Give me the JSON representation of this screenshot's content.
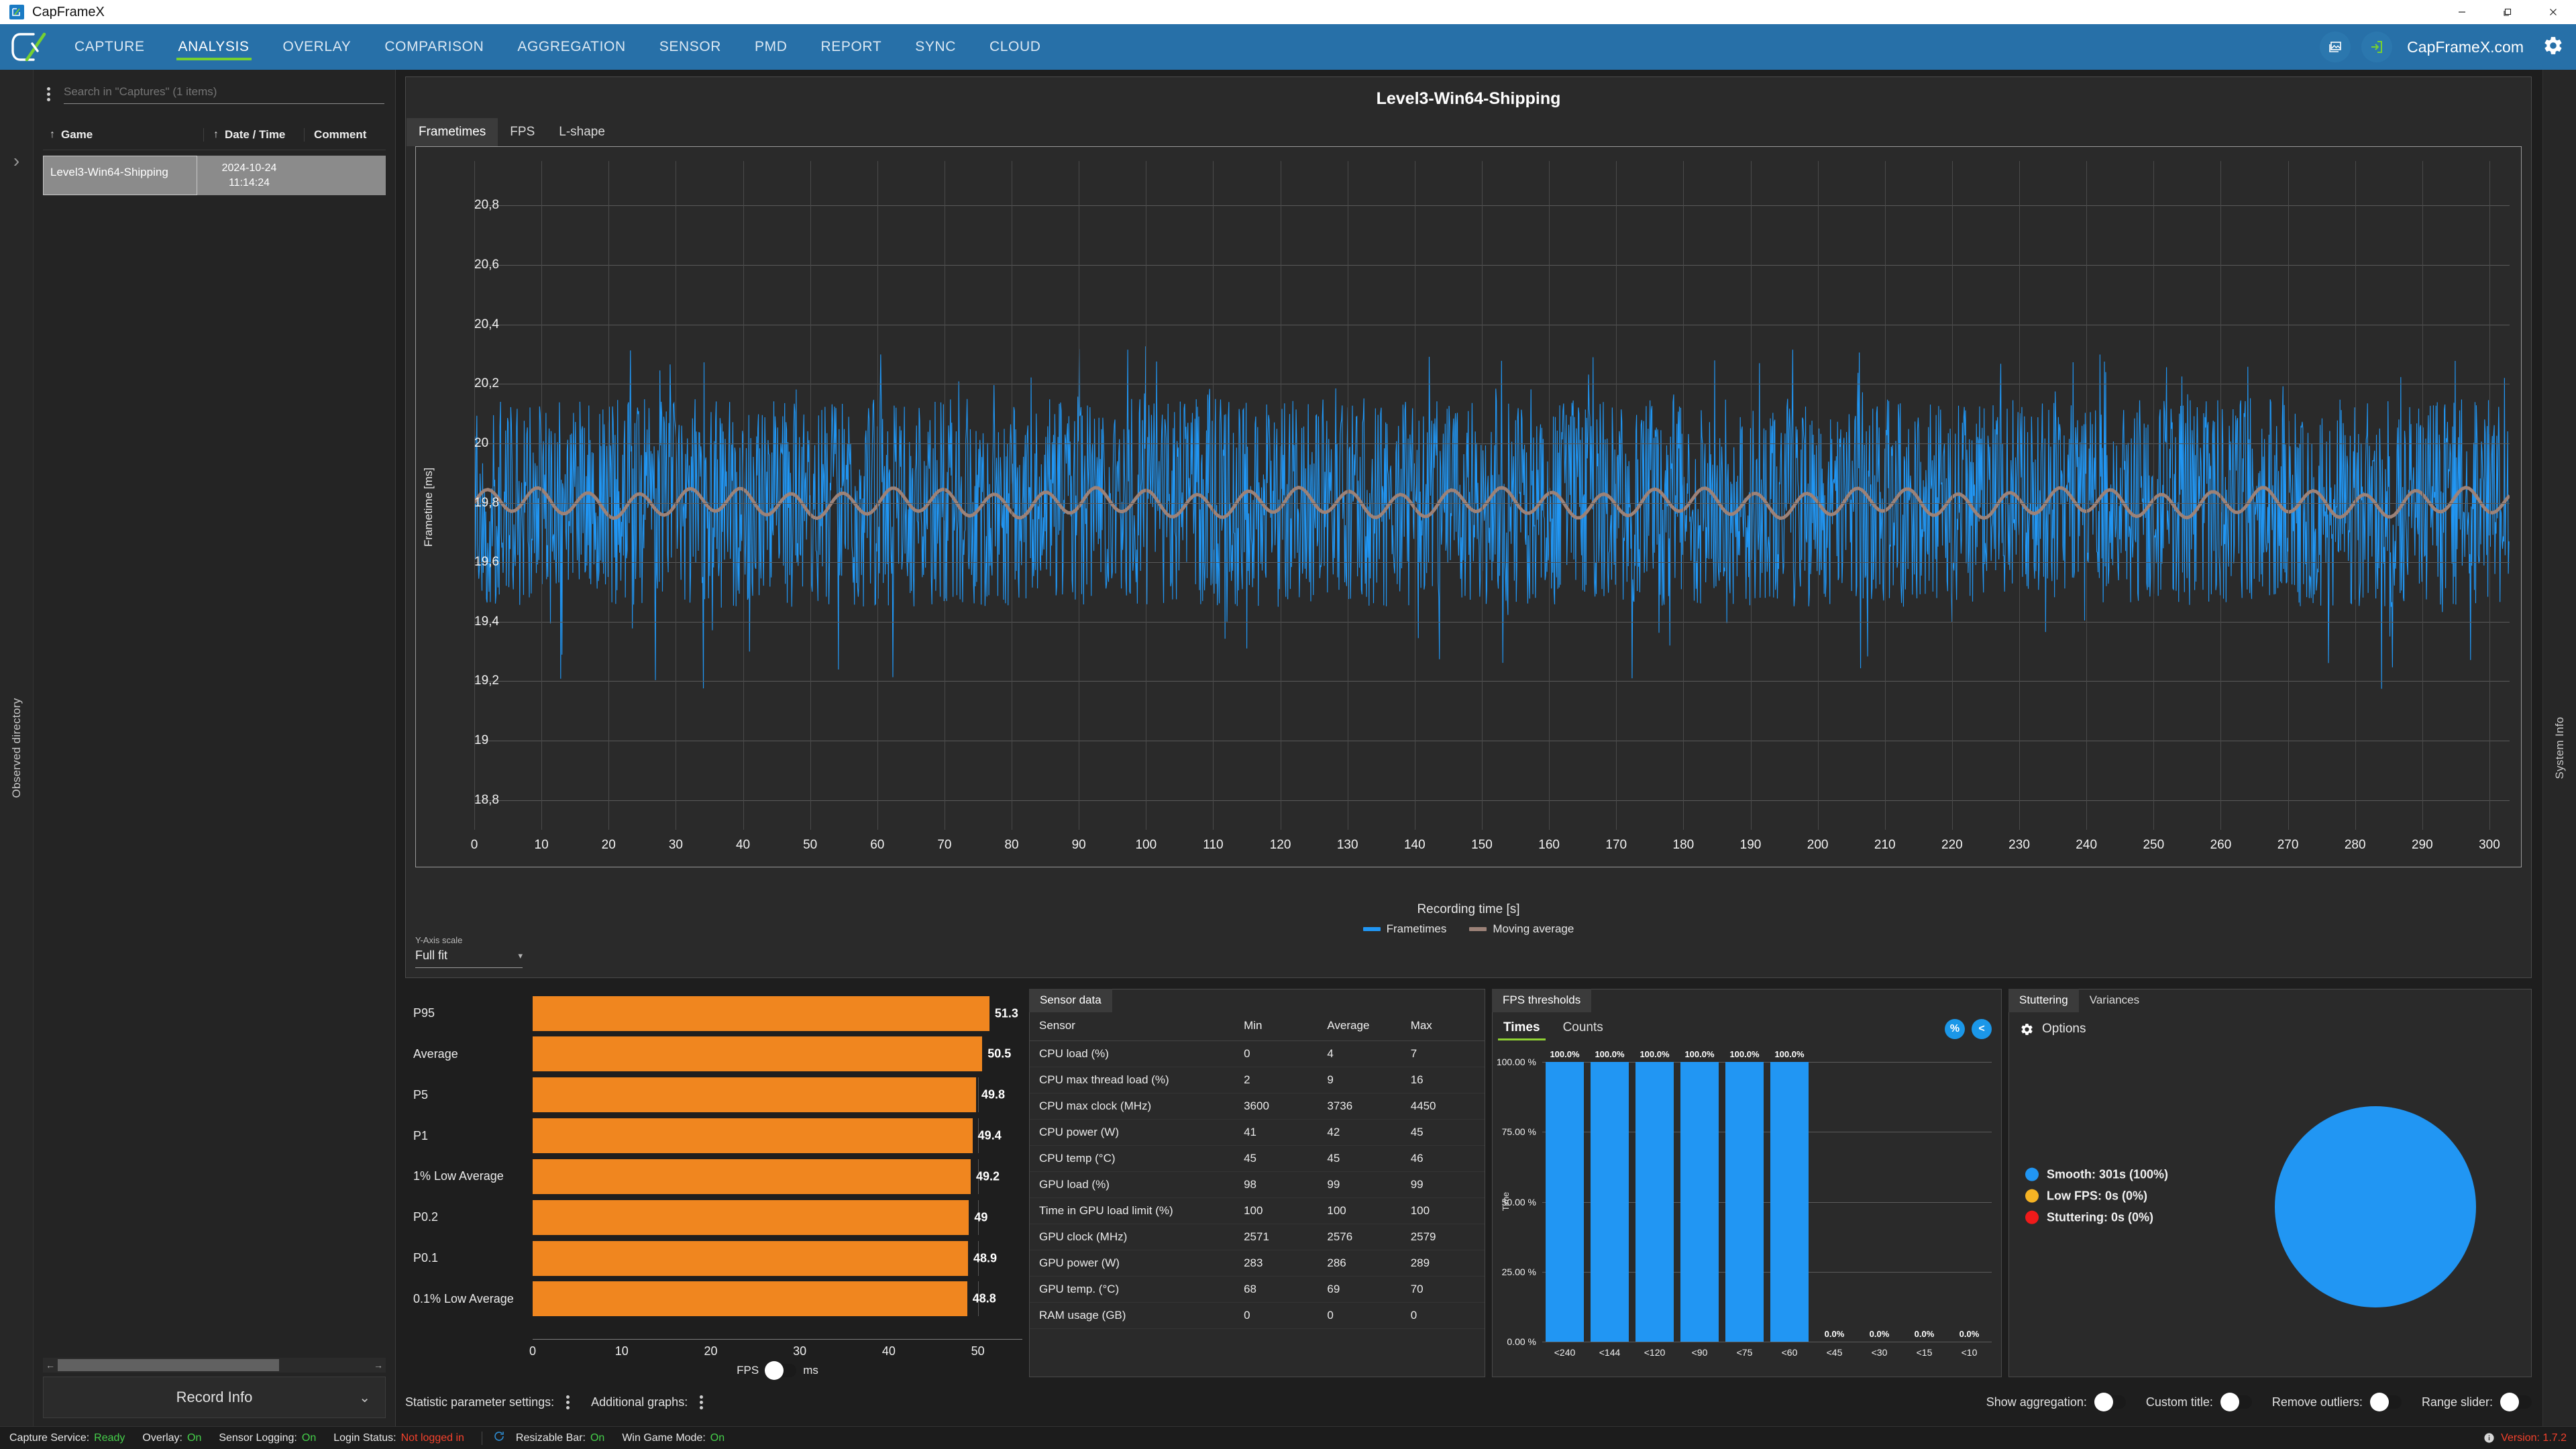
{
  "window": {
    "app_title": "CapFrameX",
    "logo_text": "CX",
    "minimize": "—",
    "maximize": "❐",
    "close": "✕"
  },
  "nav": {
    "items": [
      {
        "label": "CAPTURE",
        "active": false
      },
      {
        "label": "ANALYSIS",
        "active": true
      },
      {
        "label": "OVERLAY",
        "active": false
      },
      {
        "label": "COMPARISON",
        "active": false
      },
      {
        "label": "AGGREGATION",
        "active": false
      },
      {
        "label": "SENSOR",
        "active": false
      },
      {
        "label": "PMD",
        "active": false
      },
      {
        "label": "REPORT",
        "active": false
      },
      {
        "label": "SYNC",
        "active": false
      },
      {
        "label": "CLOUD",
        "active": false
      }
    ],
    "screenshot_icon": "image-icon",
    "login_icon": "login-icon",
    "site_link": "CapFrameX.com",
    "settings_icon": "gear-icon"
  },
  "left_rail": {
    "expand_icon": "chevron-right-icon",
    "label": "Observed directory"
  },
  "right_rail": {
    "label": "System Info"
  },
  "captures": {
    "kebab_icon": "kebab-menu-icon",
    "search_placeholder": "Search in \"Captures\" (1 items)",
    "search_value": "",
    "columns": [
      "Game",
      "Date / Time",
      "Comment"
    ],
    "rows": [
      {
        "game": "Level3-Win64-Shipping",
        "date": "2024-10-24",
        "time": "11:14:24",
        "comment": ""
      }
    ],
    "record_info": "Record Info",
    "record_info_chevron": "chevron-down-icon"
  },
  "chart_card": {
    "title": "Level3-Win64-Shipping",
    "tabs": [
      {
        "label": "Frametimes",
        "active": true
      },
      {
        "label": "FPS",
        "active": false
      },
      {
        "label": "L-shape",
        "active": false
      }
    ],
    "yaxis_scale_label": "Y-Axis scale",
    "yaxis_scale_value": "Full fit",
    "caret": "▾"
  },
  "chart_data": {
    "type": "line",
    "title": "Level3-Win64-Shipping",
    "xlabel": "Recording time [s]",
    "ylabel": "Frametime [ms]",
    "xlim": [
      0,
      303
    ],
    "ylim": [
      18.7,
      20.95
    ],
    "xticks": [
      0,
      10,
      20,
      30,
      40,
      50,
      60,
      70,
      80,
      90,
      100,
      110,
      120,
      130,
      140,
      150,
      160,
      170,
      180,
      190,
      200,
      210,
      220,
      230,
      240,
      250,
      260,
      270,
      280,
      290,
      300
    ],
    "ytick_labels": [
      "18,8",
      "19",
      "19,2",
      "19,4",
      "19,6",
      "19,8",
      "20",
      "20,2",
      "20,4",
      "20,6",
      "20,8"
    ],
    "yticks": [
      18.8,
      19.0,
      19.2,
      19.4,
      19.6,
      19.8,
      20.0,
      20.2,
      20.4,
      20.6,
      20.8
    ],
    "grid": true,
    "legend_position": "bottom",
    "series": [
      {
        "name": "Frametimes",
        "color": "#2196f3",
        "band_low": 19.45,
        "band_high": 20.15,
        "mean": 19.8
      },
      {
        "name": "Moving average",
        "color": "#9c8278",
        "mean": 19.8,
        "amplitude": 0.04
      }
    ]
  },
  "stats_chart": {
    "chart_data": {
      "type": "bar",
      "orientation": "horizontal",
      "categories": [
        "P95",
        "Average",
        "P5",
        "P1",
        "1% Low Average",
        "P0.2",
        "P0.1",
        "0.1% Low Average"
      ],
      "values": [
        51.3,
        50.5,
        49.8,
        49.4,
        49.2,
        49,
        48.9,
        48.8
      ],
      "value_labels": [
        "51.3",
        "50.5",
        "49.8",
        "49.4",
        "49.2",
        "49",
        "48.9",
        "48.8"
      ],
      "xticks": [
        0,
        10,
        20,
        30,
        40,
        50
      ],
      "xlim": [
        0,
        55
      ],
      "bar_color": "#f0861f",
      "xlabel": ""
    },
    "unit_left": "FPS",
    "unit_right": "ms"
  },
  "sensor_panel": {
    "tab": "Sensor data",
    "columns": [
      "Sensor",
      "Min",
      "Average",
      "Max"
    ],
    "rows": [
      {
        "sensor": "CPU load (%)",
        "min": "0",
        "avg": "4",
        "max": "7"
      },
      {
        "sensor": "CPU max thread load (%)",
        "min": "2",
        "avg": "9",
        "max": "16"
      },
      {
        "sensor": "CPU max clock (MHz)",
        "min": "3600",
        "avg": "3736",
        "max": "4450"
      },
      {
        "sensor": "CPU power (W)",
        "min": "41",
        "avg": "42",
        "max": "45"
      },
      {
        "sensor": "CPU temp (°C)",
        "min": "45",
        "avg": "45",
        "max": "46"
      },
      {
        "sensor": "GPU load (%)",
        "min": "98",
        "avg": "99",
        "max": "99"
      },
      {
        "sensor": "Time in GPU load limit (%)",
        "min": "100",
        "avg": "100",
        "max": "100"
      },
      {
        "sensor": "GPU clock (MHz)",
        "min": "2571",
        "avg": "2576",
        "max": "2579"
      },
      {
        "sensor": "GPU power (W)",
        "min": "283",
        "avg": "286",
        "max": "289"
      },
      {
        "sensor": "GPU temp. (°C)",
        "min": "68",
        "avg": "69",
        "max": "70"
      },
      {
        "sensor": "RAM usage (GB)",
        "min": "0",
        "avg": "0",
        "max": "0"
      }
    ]
  },
  "thresholds_panel": {
    "tab": "FPS thresholds",
    "subtabs": [
      {
        "label": "Times",
        "active": true
      },
      {
        "label": "Counts",
        "active": false
      }
    ],
    "percent_button": "%",
    "less_button": "<",
    "chart_data": {
      "type": "bar",
      "categories": [
        "<240",
        "<144",
        "<120",
        "<90",
        "<75",
        "<60",
        "<45",
        "<30",
        "<15",
        "<10"
      ],
      "values": [
        100.0,
        100.0,
        100.0,
        100.0,
        100.0,
        100.0,
        0.0,
        0.0,
        0.0,
        0.0
      ],
      "value_labels": [
        "100.0%",
        "100.0%",
        "100.0%",
        "100.0%",
        "100.0%",
        "100.0%",
        "0.0%",
        "0.0%",
        "0.0%",
        "0.0%"
      ],
      "ylabel": "Time",
      "ytick_labels": [
        "0.00 %",
        "25.00 %",
        "50.00 %",
        "75.00 %",
        "100.00 %"
      ],
      "ylim": [
        0,
        100
      ],
      "bar_color": "#2196f3"
    }
  },
  "stutter_panel": {
    "tabs": [
      {
        "label": "Stuttering",
        "active": true
      },
      {
        "label": "Variances",
        "active": false
      }
    ],
    "options_label": "Options",
    "options_icon": "gear-icon",
    "chart_data": {
      "type": "pie",
      "labels": [
        "Smooth",
        "Low FPS",
        "Stuttering"
      ],
      "values": [
        100,
        0,
        0
      ],
      "display": [
        "Smooth:  301s (100%)",
        "Low FPS:  0s (0%)",
        "Stuttering:  0s (0%)"
      ],
      "colors": [
        "#2196f3",
        "#f5b324",
        "#f01a1a"
      ]
    }
  },
  "bottom_toolbar": {
    "statistic_settings_label": "Statistic parameter settings:",
    "additional_graphs_label": "Additional graphs:",
    "toggles": [
      {
        "label": "Show aggregation:",
        "on": false
      },
      {
        "label": "Custom title:",
        "on": false
      },
      {
        "label": "Remove outliers:",
        "on": false
      },
      {
        "label": "Range slider:",
        "on": false
      }
    ]
  },
  "status_bar": {
    "items": [
      {
        "key": "Capture Service:",
        "value": "Ready",
        "state": "on"
      },
      {
        "key": "Overlay:",
        "value": "On",
        "state": "on"
      },
      {
        "key": "Sensor Logging:",
        "value": "On",
        "state": "on"
      },
      {
        "key": "Login Status:",
        "value": "Not logged in",
        "state": "error"
      }
    ],
    "refresh_icon": "refresh-icon",
    "items2": [
      {
        "key": "Resizable Bar:",
        "value": "On",
        "state": "on"
      },
      {
        "key": "Win Game Mode:",
        "value": "On",
        "state": "on"
      }
    ],
    "info_icon": "info-icon",
    "version": "Version: 1.7.2"
  }
}
